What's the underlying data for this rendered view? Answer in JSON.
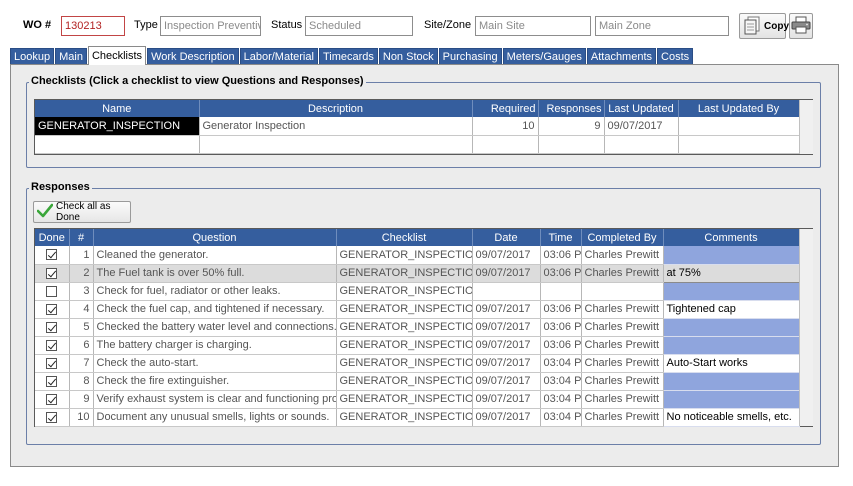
{
  "header": {
    "wo_label": "WO #",
    "wo_value": "130213",
    "type_label": "Type",
    "type_value": "Inspection Preventive",
    "status_label": "Status",
    "status_value": "Scheduled",
    "site_label": "Site/Zone",
    "site_value": "Main Site",
    "zone_value": "Main Zone",
    "copy_label": "Copy"
  },
  "tabs": [
    "Lookup",
    "Main",
    "Checklists",
    "Work Description",
    "Labor/Material",
    "Timecards",
    "Non Stock",
    "Purchasing",
    "Meters/Gauges",
    "Attachments",
    "Costs"
  ],
  "active_tab": "Checklists",
  "checklists": {
    "title": "Checklists (Click a checklist to view Questions and Responses)",
    "columns": [
      "Name",
      "Description",
      "Required",
      "Responses",
      "Last Updated",
      "Last Updated By"
    ],
    "rows": [
      {
        "name": "GENERATOR_INSPECTION",
        "description": "Generator Inspection",
        "required": "10",
        "responses": "9",
        "last_updated": "09/07/2017",
        "last_updated_by": ""
      }
    ]
  },
  "responses": {
    "title": "Responses",
    "check_all_label": "Check all as Done",
    "columns": [
      "Done",
      "#",
      "Question",
      "Checklist",
      "Date",
      "Time",
      "Completed By",
      "Comments"
    ],
    "rows": [
      {
        "done": true,
        "num": "1",
        "question": "Cleaned the generator.",
        "checklist": "GENERATOR_INSPECTION",
        "date": "09/07/2017",
        "time": "03:06 P",
        "completed_by": "Charles Prewitt",
        "comments": ""
      },
      {
        "done": true,
        "num": "2",
        "question": "The Fuel tank is over 50% full.",
        "checklist": "GENERATOR_INSPECTION",
        "date": "09/07/2017",
        "time": "03:06 P",
        "completed_by": "Charles Prewitt",
        "comments": "at 75%"
      },
      {
        "done": false,
        "num": "3",
        "question": "Check for fuel, radiator or other leaks.",
        "checklist": "GENERATOR_INSPECTION",
        "date": "",
        "time": "",
        "completed_by": "",
        "comments": ""
      },
      {
        "done": true,
        "num": "4",
        "question": "Check the fuel cap, and tightened if necessary.",
        "checklist": "GENERATOR_INSPECTION",
        "date": "09/07/2017",
        "time": "03:06 P",
        "completed_by": "Charles Prewitt",
        "comments": "Tightened cap"
      },
      {
        "done": true,
        "num": "5",
        "question": "Checked the battery water level and connections.",
        "checklist": "GENERATOR_INSPECTION",
        "date": "09/07/2017",
        "time": "03:06 P",
        "completed_by": "Charles Prewitt",
        "comments": ""
      },
      {
        "done": true,
        "num": "6",
        "question": "The battery charger is charging.",
        "checklist": "GENERATOR_INSPECTION",
        "date": "09/07/2017",
        "time": "03:06 P",
        "completed_by": "Charles Prewitt",
        "comments": ""
      },
      {
        "done": true,
        "num": "7",
        "question": "Check the auto-start.",
        "checklist": "GENERATOR_INSPECTION",
        "date": "09/07/2017",
        "time": "03:04 P",
        "completed_by": "Charles Prewitt",
        "comments": "Auto-Start works"
      },
      {
        "done": true,
        "num": "8",
        "question": "Check the fire extinguisher.",
        "checklist": "GENERATOR_INSPECTION",
        "date": "09/07/2017",
        "time": "03:04 P",
        "completed_by": "Charles Prewitt",
        "comments": ""
      },
      {
        "done": true,
        "num": "9",
        "question": "Verify exhaust system is clear and functioning proper",
        "checklist": "GENERATOR_INSPECTION",
        "date": "09/07/2017",
        "time": "03:04 P",
        "completed_by": "Charles Prewitt",
        "comments": ""
      },
      {
        "done": true,
        "num": "10",
        "question": "Document any unusual smells, lights or sounds.",
        "checklist": "GENERATOR_INSPECTION",
        "date": "09/07/2017",
        "time": "03:04 P",
        "completed_by": "Charles Prewitt",
        "comments": "No noticeable smells, etc."
      }
    ]
  },
  "colors": {
    "header_blue": "#355e9e",
    "comment_blue": "#8fa5dd",
    "wo_red": "#b22222",
    "check_green": "#3aa63a"
  },
  "icons": {
    "copy": "copy-document-icon",
    "print": "printer-icon",
    "check_all": "green-checkmark-icon"
  }
}
